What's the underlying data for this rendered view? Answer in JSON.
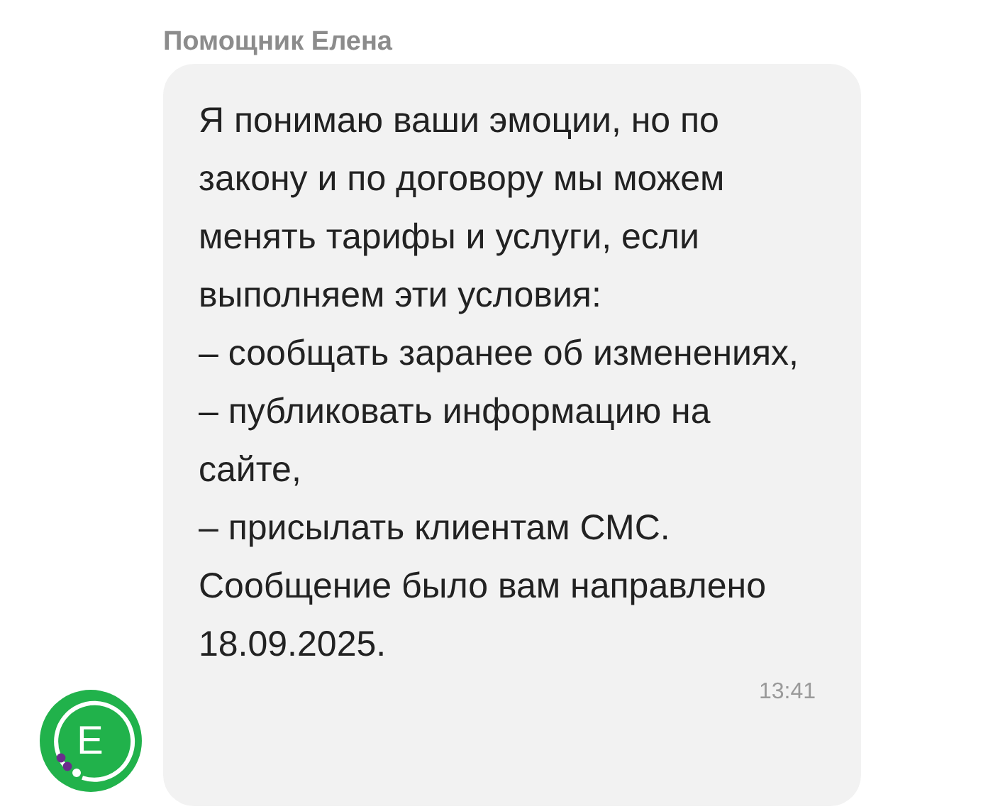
{
  "sender": "Помощник Елена",
  "avatar": {
    "letter": "Е"
  },
  "message": {
    "text": "Я понимаю ваши эмоции, но по закону и по договору мы можем менять тарифы и услуги, если выполняем эти условия:\n– сообщать заранее об изменениях,\n– публиковать информацию на сайте,\n– присылать клиентам СМС.\nСообщение было вам направлено 18.09.2025.",
    "time": "13:41"
  }
}
